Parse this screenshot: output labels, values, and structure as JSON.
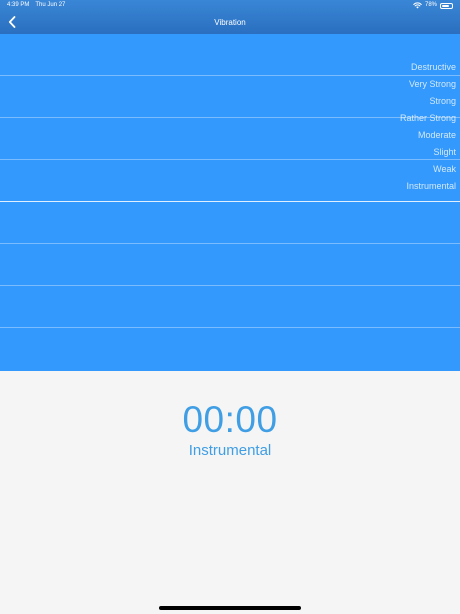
{
  "status_bar": {
    "time": "4:39 PM",
    "date": "Thu Jun 27",
    "battery_percent": "78%",
    "battery_level": 0.78
  },
  "nav": {
    "title": "Vibration"
  },
  "scale": {
    "levels": [
      "Destructive",
      "Very Strong",
      "Strong",
      "Rather Strong",
      "Moderate",
      "Slight",
      "Weak",
      "Instrumental"
    ]
  },
  "readout": {
    "timer": "00:00",
    "level": "Instrumental"
  },
  "colors": {
    "header": "#2a6fc0",
    "scale_background": "#3399fc",
    "accent_text": "#3f9ee4",
    "page_background": "#f5f5f5"
  }
}
